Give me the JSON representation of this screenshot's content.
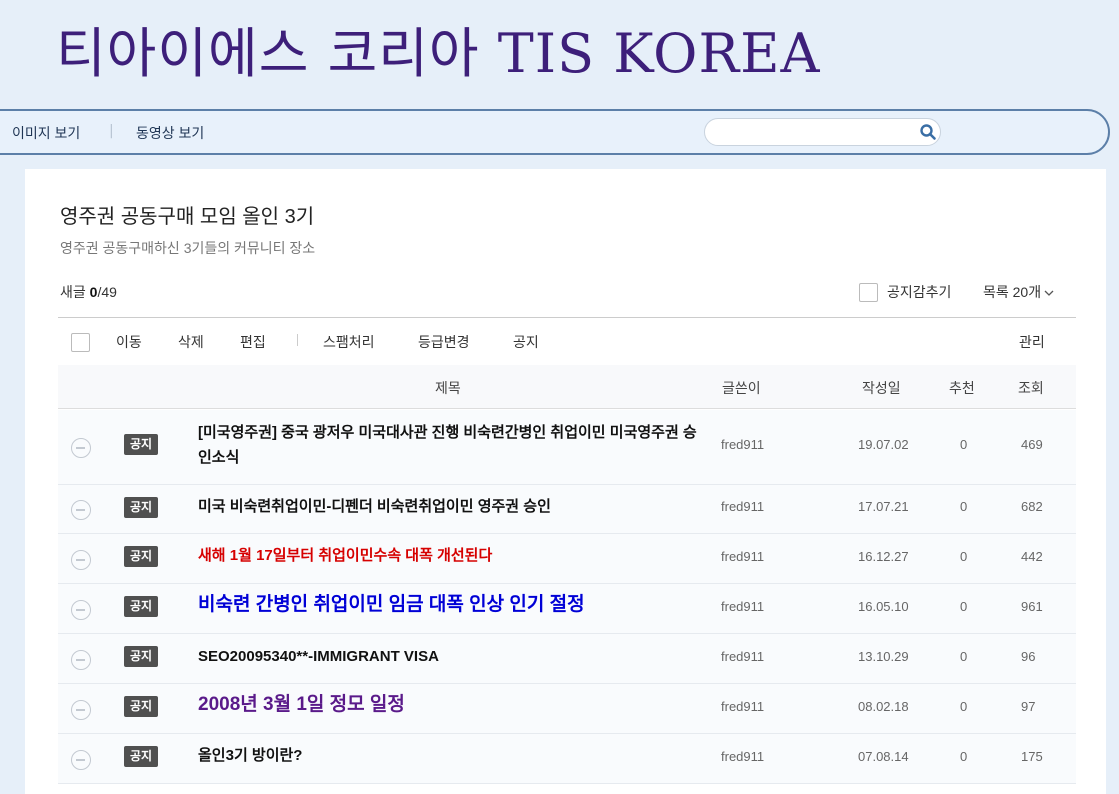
{
  "banner": {
    "title": "티아이에스 코리아 TIS KOREA"
  },
  "nav": {
    "items": [
      "이미지 보기",
      "동영상 보기"
    ],
    "separator": "|"
  },
  "search": {
    "placeholder": ""
  },
  "cafe": {
    "title": "영주권 공동구매 모임 올인 3기",
    "description": "영주권 공동구매하신 3기들의 커뮤니티 장소"
  },
  "summary": {
    "new_label": "새글",
    "new_count": "0",
    "total": "/49"
  },
  "options": {
    "hide_notice": "공지감추기",
    "per_page": "목록 20개"
  },
  "toolbar": {
    "move": "이동",
    "delete": "삭제",
    "edit": "편집",
    "spam": "스팸처리",
    "grade": "등급변경",
    "notice": "공지",
    "manage": "관리"
  },
  "columns": {
    "subject": "제목",
    "author": "글쓴이",
    "date": "작성일",
    "likes": "추천",
    "views": "조회"
  },
  "colors": {
    "title": "#3d1f7a",
    "red": "#d60000",
    "blue": "#0000d6",
    "purple": "#5a1a8a"
  },
  "posts": [
    {
      "badge": "공지",
      "subject": "[미국영주권] 중국 광저우 미국대사관 진행 비숙련간병인 취업이민 미국영주권 승인소식",
      "author": "fred911",
      "date": "19.07.02",
      "likes": "0",
      "views": "469"
    },
    {
      "badge": "공지",
      "subject": "미국 비숙련취업이민-디펜더 비숙련취업이민 영주권 승인",
      "author": "fred911",
      "date": "17.07.21",
      "likes": "0",
      "views": "682"
    },
    {
      "badge": "공지",
      "subject": "새해 1월 17일부터 취업이민수속 대폭 개선된다",
      "author": "fred911",
      "date": "16.12.27",
      "likes": "0",
      "views": "442"
    },
    {
      "badge": "공지",
      "subject": "비숙련 간병인 취업이민 임금 대폭 인상 인기 절정",
      "author": "fred911",
      "date": "16.05.10",
      "likes": "0",
      "views": "961"
    },
    {
      "badge": "공지",
      "subject": "SEO20095340**-IMMIGRANT VISA",
      "author": "fred911",
      "date": "13.10.29",
      "likes": "0",
      "views": "96"
    },
    {
      "badge": "공지",
      "subject": "2008년 3월 1일 정모 일정",
      "author": "fred911",
      "date": "08.02.18",
      "likes": "0",
      "views": "97"
    },
    {
      "badge": "공지",
      "subject": "올인3기 방이란?",
      "author": "fred911",
      "date": "07.08.14",
      "likes": "0",
      "views": "175"
    }
  ]
}
